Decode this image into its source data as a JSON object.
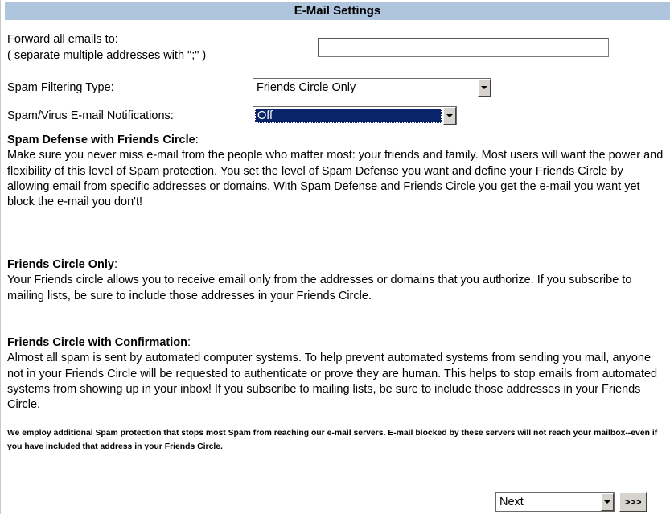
{
  "header": {
    "title": "E-Mail Settings"
  },
  "forward": {
    "label_line1": "Forward all emails to:",
    "label_line2": "( separate multiple addresses with \";\" )",
    "value": ""
  },
  "spam_type": {
    "label": "Spam Filtering Type:",
    "value": "Friends Circle Only"
  },
  "notifications": {
    "label": "Spam/Virus E-mail Notifications:",
    "value": "Off"
  },
  "sections": [
    {
      "heading": "Spam Defense with Friends Circle",
      "body": "Make sure you never miss e-mail from the people who matter most: your friends and family. Most users will want the power and flexibility of this level of Spam protection. You set the level of Spam Defense you want and define your Friends Circle by allowing email from specific addresses or domains. With Spam Defense and Friends Circle you get the e-mail you want yet block the e-mail you don't!"
    },
    {
      "heading": "Friends Circle Only",
      "body": "Your Friends circle allows you to receive email only from the addresses or domains that you authorize. If you subscribe to mailing lists, be sure to include those addresses in your Friends Circle."
    },
    {
      "heading": "Friends Circle with Confirmation",
      "body": "Almost all spam is sent by automated computer systems. To help prevent automated systems from sending you mail, anyone not in your Friends Circle will be requested to authenticate or prove they are human. This helps to stop emails from automated systems from showing up in your inbox! If you subscribe to mailing lists, be sure to include those addresses in your Friends Circle."
    }
  ],
  "footnote": "We employ additional Spam protection that stops most Spam from reaching our e-mail servers. E-mail blocked by these servers will not reach your mailbox--even if you have included that address in your Friends Circle.",
  "nav": {
    "select_value": "Next",
    "go_label": ">>>"
  },
  "colors": {
    "header_bg": "#afc4dd",
    "selection": "#0a246a"
  },
  "icons": {
    "dropdown": "chevron-down-icon"
  }
}
